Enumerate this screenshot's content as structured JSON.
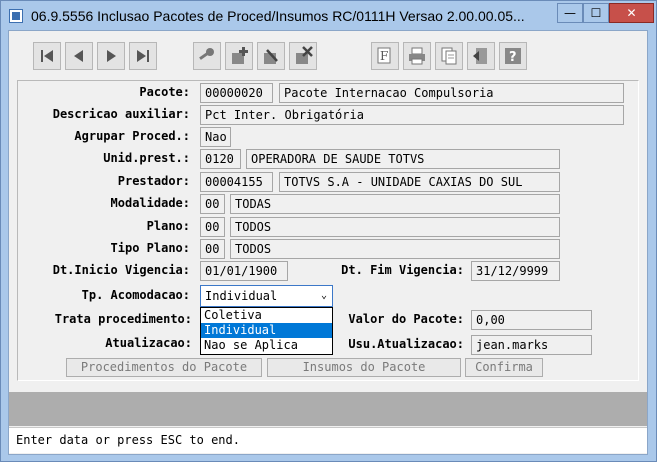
{
  "window": {
    "title": "06.9.5556  Inclusao  Pacotes de Proced/Insumos RC/0111H Versao 2.00.00.05...",
    "min_glyph": "—",
    "max_glyph": "☐",
    "close_glyph": "✕"
  },
  "toolbar": {
    "icons": [
      "first-record-icon",
      "previous-record-icon",
      "next-record-icon",
      "last-record-icon",
      "search-key-icon",
      "add-record-icon",
      "edit-record-icon",
      "delete-record-icon",
      "filter-icon",
      "print-icon",
      "copy-icon",
      "exit-icon",
      "help-icon"
    ]
  },
  "form": {
    "pacote": {
      "label": "Pacote:",
      "code": "00000020",
      "name": "Pacote Internacao Compulsoria"
    },
    "descricao": {
      "label": "Descricao auxiliar:",
      "value": "Pct Inter. Obrigatória"
    },
    "agrupar": {
      "label": "Agrupar Proced.:",
      "value": "Nao"
    },
    "unid_prest": {
      "label": "Unid.prest.:",
      "code": "0120",
      "name": "OPERADORA DE SAUDE TOTVS"
    },
    "prestador": {
      "label": "Prestador:",
      "code": "00004155",
      "name": "TOTVS S.A - UNIDADE CAXIAS DO SUL"
    },
    "modalidade": {
      "label": "Modalidade:",
      "code": "00",
      "name": "TODAS"
    },
    "plano": {
      "label": "Plano:",
      "code": "00",
      "name": "TODOS"
    },
    "tipo_plano": {
      "label": "Tipo Plano:",
      "code": "00",
      "name": "TODOS"
    },
    "dt_inicio": {
      "label": "Dt.Inicio Vigencia:",
      "value": "01/01/1900"
    },
    "dt_fim": {
      "label": "Dt. Fim Vigencia:",
      "value": "31/12/9999"
    },
    "tp_acomodacao": {
      "label": "Tp. Acomodacao:",
      "selected": "Individual",
      "options": [
        "Coletiva",
        "Individual",
        "Nao se Aplica"
      ],
      "highlighted": "Individual"
    },
    "trata_proc": {
      "label": "Trata procedimento:"
    },
    "valor": {
      "label": "Valor do Pacote:",
      "value": "0,00"
    },
    "atualizacao": {
      "label": "Atualizacao:"
    },
    "usu_atualizacao": {
      "label": "Usu.Atualizacao:",
      "value": "jean.marks"
    }
  },
  "buttons": {
    "procedimentos": "Procedimentos do Pacote",
    "insumos": "Insumos do Pacote",
    "confirma": "Confirma"
  },
  "status": {
    "text": "Enter data or press ESC to end."
  }
}
